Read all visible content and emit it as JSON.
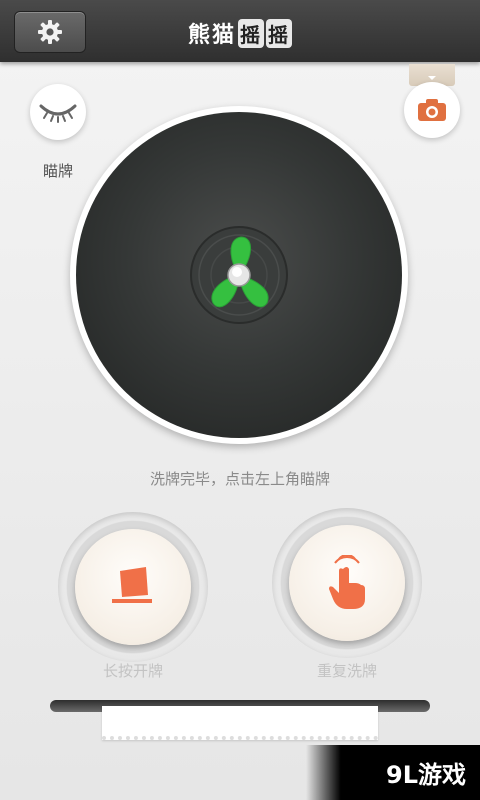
{
  "header": {
    "title_plain": "熊猫",
    "title_boxed_1": "摇",
    "title_boxed_2": "摇",
    "settings_icon": "gear-icon"
  },
  "peek": {
    "label": "瞄牌",
    "icon": "closed-eye-icon"
  },
  "camera": {
    "icon": "camera-icon"
  },
  "dial": {
    "icon": "fan-icon",
    "accent": "#3cc03c"
  },
  "status": "洗牌完毕，点击左上角瞄牌",
  "actions": {
    "open_label": "长按开牌",
    "open_icon": "card-icon",
    "reshuffle_label": "重复洗牌",
    "reshuffle_icon": "hand-tap-icon",
    "accent": "#f07048"
  },
  "watermark": "9L游戏"
}
